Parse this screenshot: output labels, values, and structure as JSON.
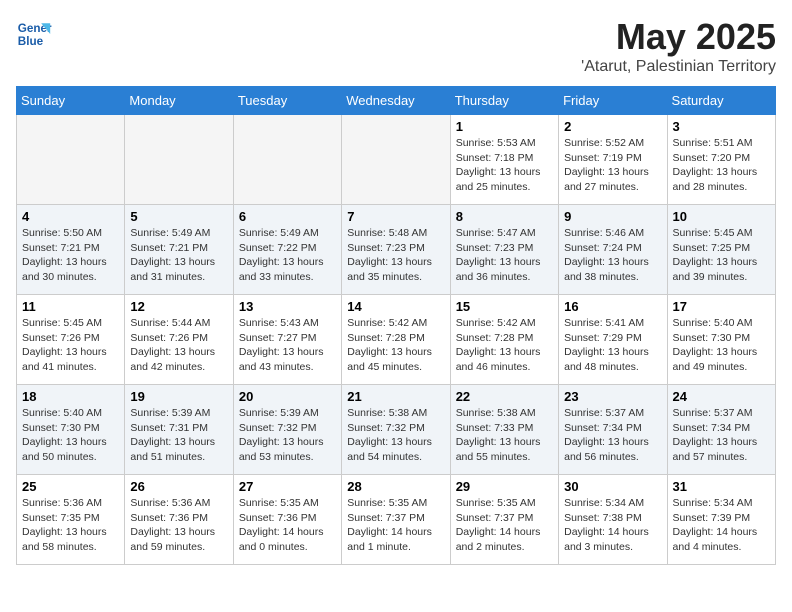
{
  "logo": {
    "line1": "General",
    "line2": "Blue"
  },
  "title": {
    "month_year": "May 2025",
    "location": "'Atarut, Palestinian Territory"
  },
  "weekdays": [
    "Sunday",
    "Monday",
    "Tuesday",
    "Wednesday",
    "Thursday",
    "Friday",
    "Saturday"
  ],
  "weeks": [
    [
      {
        "day": "",
        "info": "",
        "empty": true
      },
      {
        "day": "",
        "info": "",
        "empty": true
      },
      {
        "day": "",
        "info": "",
        "empty": true
      },
      {
        "day": "",
        "info": "",
        "empty": true
      },
      {
        "day": "1",
        "info": "Sunrise: 5:53 AM\nSunset: 7:18 PM\nDaylight: 13 hours\nand 25 minutes."
      },
      {
        "day": "2",
        "info": "Sunrise: 5:52 AM\nSunset: 7:19 PM\nDaylight: 13 hours\nand 27 minutes."
      },
      {
        "day": "3",
        "info": "Sunrise: 5:51 AM\nSunset: 7:20 PM\nDaylight: 13 hours\nand 28 minutes."
      }
    ],
    [
      {
        "day": "4",
        "info": "Sunrise: 5:50 AM\nSunset: 7:21 PM\nDaylight: 13 hours\nand 30 minutes."
      },
      {
        "day": "5",
        "info": "Sunrise: 5:49 AM\nSunset: 7:21 PM\nDaylight: 13 hours\nand 31 minutes."
      },
      {
        "day": "6",
        "info": "Sunrise: 5:49 AM\nSunset: 7:22 PM\nDaylight: 13 hours\nand 33 minutes."
      },
      {
        "day": "7",
        "info": "Sunrise: 5:48 AM\nSunset: 7:23 PM\nDaylight: 13 hours\nand 35 minutes."
      },
      {
        "day": "8",
        "info": "Sunrise: 5:47 AM\nSunset: 7:23 PM\nDaylight: 13 hours\nand 36 minutes."
      },
      {
        "day": "9",
        "info": "Sunrise: 5:46 AM\nSunset: 7:24 PM\nDaylight: 13 hours\nand 38 minutes."
      },
      {
        "day": "10",
        "info": "Sunrise: 5:45 AM\nSunset: 7:25 PM\nDaylight: 13 hours\nand 39 minutes."
      }
    ],
    [
      {
        "day": "11",
        "info": "Sunrise: 5:45 AM\nSunset: 7:26 PM\nDaylight: 13 hours\nand 41 minutes."
      },
      {
        "day": "12",
        "info": "Sunrise: 5:44 AM\nSunset: 7:26 PM\nDaylight: 13 hours\nand 42 minutes."
      },
      {
        "day": "13",
        "info": "Sunrise: 5:43 AM\nSunset: 7:27 PM\nDaylight: 13 hours\nand 43 minutes."
      },
      {
        "day": "14",
        "info": "Sunrise: 5:42 AM\nSunset: 7:28 PM\nDaylight: 13 hours\nand 45 minutes."
      },
      {
        "day": "15",
        "info": "Sunrise: 5:42 AM\nSunset: 7:28 PM\nDaylight: 13 hours\nand 46 minutes."
      },
      {
        "day": "16",
        "info": "Sunrise: 5:41 AM\nSunset: 7:29 PM\nDaylight: 13 hours\nand 48 minutes."
      },
      {
        "day": "17",
        "info": "Sunrise: 5:40 AM\nSunset: 7:30 PM\nDaylight: 13 hours\nand 49 minutes."
      }
    ],
    [
      {
        "day": "18",
        "info": "Sunrise: 5:40 AM\nSunset: 7:30 PM\nDaylight: 13 hours\nand 50 minutes."
      },
      {
        "day": "19",
        "info": "Sunrise: 5:39 AM\nSunset: 7:31 PM\nDaylight: 13 hours\nand 51 minutes."
      },
      {
        "day": "20",
        "info": "Sunrise: 5:39 AM\nSunset: 7:32 PM\nDaylight: 13 hours\nand 53 minutes."
      },
      {
        "day": "21",
        "info": "Sunrise: 5:38 AM\nSunset: 7:32 PM\nDaylight: 13 hours\nand 54 minutes."
      },
      {
        "day": "22",
        "info": "Sunrise: 5:38 AM\nSunset: 7:33 PM\nDaylight: 13 hours\nand 55 minutes."
      },
      {
        "day": "23",
        "info": "Sunrise: 5:37 AM\nSunset: 7:34 PM\nDaylight: 13 hours\nand 56 minutes."
      },
      {
        "day": "24",
        "info": "Sunrise: 5:37 AM\nSunset: 7:34 PM\nDaylight: 13 hours\nand 57 minutes."
      }
    ],
    [
      {
        "day": "25",
        "info": "Sunrise: 5:36 AM\nSunset: 7:35 PM\nDaylight: 13 hours\nand 58 minutes."
      },
      {
        "day": "26",
        "info": "Sunrise: 5:36 AM\nSunset: 7:36 PM\nDaylight: 13 hours\nand 59 minutes."
      },
      {
        "day": "27",
        "info": "Sunrise: 5:35 AM\nSunset: 7:36 PM\nDaylight: 14 hours\nand 0 minutes."
      },
      {
        "day": "28",
        "info": "Sunrise: 5:35 AM\nSunset: 7:37 PM\nDaylight: 14 hours\nand 1 minute."
      },
      {
        "day": "29",
        "info": "Sunrise: 5:35 AM\nSunset: 7:37 PM\nDaylight: 14 hours\nand 2 minutes."
      },
      {
        "day": "30",
        "info": "Sunrise: 5:34 AM\nSunset: 7:38 PM\nDaylight: 14 hours\nand 3 minutes."
      },
      {
        "day": "31",
        "info": "Sunrise: 5:34 AM\nSunset: 7:39 PM\nDaylight: 14 hours\nand 4 minutes."
      }
    ]
  ]
}
